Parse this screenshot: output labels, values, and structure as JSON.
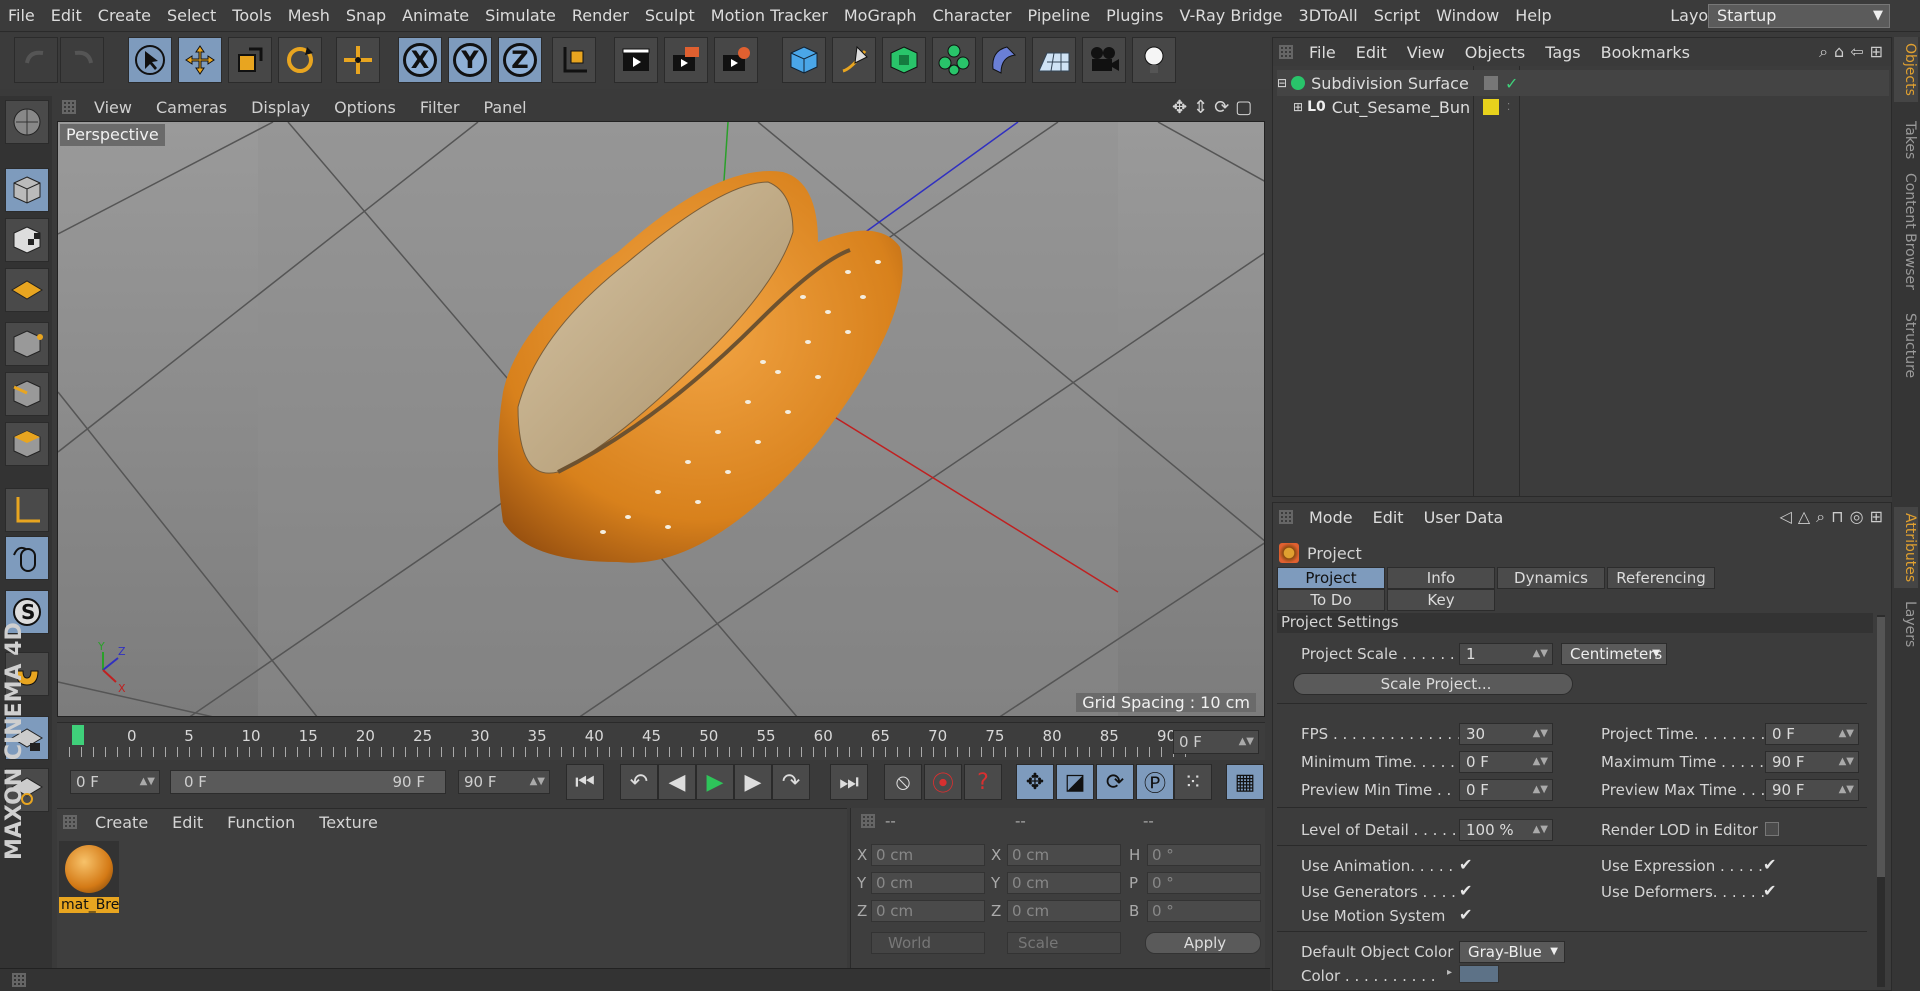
{
  "menubar": {
    "items": [
      "File",
      "Edit",
      "Create",
      "Select",
      "Tools",
      "Mesh",
      "Snap",
      "Animate",
      "Simulate",
      "Render",
      "Sculpt",
      "Motion Tracker",
      "MoGraph",
      "Character",
      "Pipeline",
      "Plugins",
      "V-Ray Bridge",
      "3DToAll",
      "Script",
      "Window",
      "Help"
    ],
    "layout_label": "Layout:",
    "layout_value": "Startup"
  },
  "axis": {
    "x": "X",
    "y": "Y",
    "z": "Z"
  },
  "viewport": {
    "menu": [
      "View",
      "Cameras",
      "Display",
      "Options",
      "Filter",
      "Panel"
    ],
    "label": "Perspective",
    "grid_spacing": "Grid Spacing : 10 cm"
  },
  "brand": "MAXON CINEMA 4D",
  "timeline": {
    "ticks": [
      "0",
      "5",
      "10",
      "15",
      "20",
      "25",
      "30",
      "35",
      "40",
      "45",
      "50",
      "55",
      "60",
      "65",
      "70",
      "75",
      "80",
      "85",
      "90"
    ],
    "current": "0 F",
    "start": "0 F",
    "range_start": "0 F",
    "range_end": "90 F",
    "end": "90 F"
  },
  "material_panel": {
    "menu": [
      "Create",
      "Edit",
      "Function",
      "Texture"
    ],
    "material_name": "mat_Bre"
  },
  "coord_panel": {
    "headers": [
      "--",
      "--",
      "--"
    ],
    "labels": [
      "X",
      "Y",
      "Z",
      "X",
      "Y",
      "Z",
      "H",
      "P",
      "B"
    ],
    "pos": [
      "0 cm",
      "0 cm",
      "0 cm"
    ],
    "size": [
      "0 cm",
      "0 cm",
      "0 cm"
    ],
    "rot": [
      "0 °",
      "0 °",
      "0 °"
    ],
    "mode1": "World",
    "mode2": "Scale",
    "apply": "Apply"
  },
  "objects_panel": {
    "menu": [
      "File",
      "Edit",
      "View",
      "Objects",
      "Tags",
      "Bookmarks"
    ],
    "items": [
      {
        "name": "Subdivision Surface"
      },
      {
        "name": "Cut_Sesame_Bun"
      }
    ]
  },
  "side_tabs": [
    "Objects",
    "Takes",
    "Content Browser",
    "Structure",
    "Attributes",
    "Layers"
  ],
  "attributes": {
    "menu": [
      "Mode",
      "Edit",
      "User Data"
    ],
    "title": "Project",
    "tabs": [
      "Project Settings",
      "Info",
      "Dynamics",
      "Referencing",
      "To Do",
      "Key Interpolation"
    ],
    "section": "Project Settings",
    "project_scale_label": "Project Scale  . . . . . .",
    "project_scale_value": "1",
    "units": "Centimeters",
    "scale_project": "Scale Project...",
    "fps_label": "FPS . . . . . . . . . . . . . . .",
    "fps_value": "30",
    "project_time_label": "Project Time. . . . . . . . .",
    "project_time_value": "0 F",
    "min_time_label": "Minimum Time. . . . .",
    "min_time_value": "0 F",
    "max_time_label": "Maximum Time . . . . .",
    "max_time_value": "90 F",
    "prev_min_label": "Preview Min Time . .",
    "prev_min_value": "0 F",
    "prev_max_label": "Preview Max Time . . .",
    "prev_max_value": "90 F",
    "lod_label": "Level of Detail . . . . .",
    "lod_value": "100 %",
    "render_lod_label": "Render LOD in Editor",
    "use_animation": "Use Animation. . . . .",
    "use_expression": "Use Expression . . . . .",
    "use_generators": "Use Generators . . . .",
    "use_deformers": "Use Deformers. . . . . .",
    "use_motion": "Use Motion System",
    "default_color_label": "Default Object Color",
    "default_color_value": "Gray-Blue",
    "color_label": "Color . . . . . . . . . .",
    "check": "✔"
  }
}
